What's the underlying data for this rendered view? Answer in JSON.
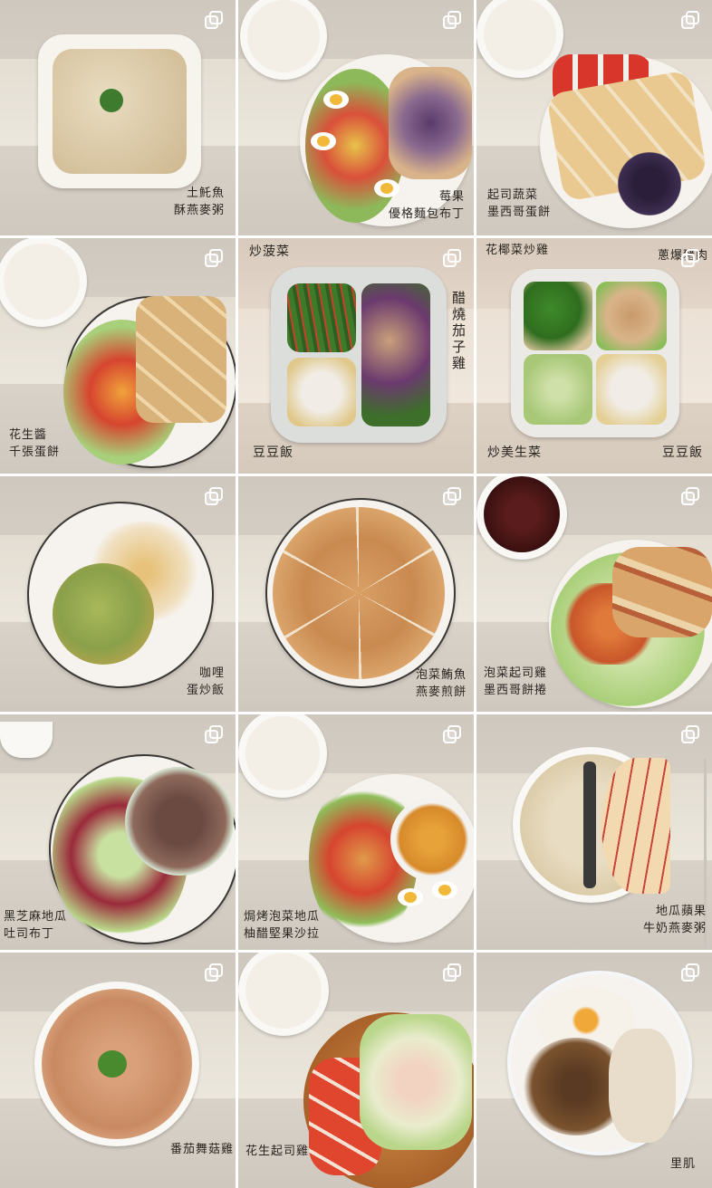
{
  "grid": {
    "tiles": [
      {
        "caption_lines": [
          "土魠魚",
          "酥燕麥粥"
        ]
      },
      {
        "caption_lines": [
          "莓果",
          "優格麵包布丁"
        ]
      },
      {
        "caption_lines": [
          "起司蔬菜",
          "墨西哥蛋餅"
        ]
      },
      {
        "caption_lines": [
          "花生醬",
          "千張蛋餅"
        ]
      },
      {
        "caption_top_left": "炒菠菜",
        "caption_right_vertical": "醋燒茄子雞",
        "caption_bottom": "豆豆飯"
      },
      {
        "caption_top_left": "花椰菜炒雞",
        "caption_top_right": "蔥爆豬肉",
        "caption_bottom_left": "炒美生菜",
        "caption_bottom_right": "豆豆飯"
      },
      {
        "caption_lines": [
          "咖哩",
          "蛋炒飯"
        ]
      },
      {
        "caption_lines": [
          "泡菜鮪魚",
          "燕麥煎餅"
        ]
      },
      {
        "caption_lines": [
          "泡菜起司雞",
          "墨西哥餅捲"
        ]
      },
      {
        "caption_lines": [
          "黑芝麻地瓜",
          "吐司布丁"
        ]
      },
      {
        "caption_lines": [
          "焗烤泡菜地瓜",
          "柚醋堅果沙拉"
        ]
      },
      {
        "caption_lines": [
          "地瓜蘋果",
          "牛奶燕麥粥"
        ]
      },
      {
        "caption_lines": [
          "番茄舞菇雞"
        ]
      },
      {
        "caption_lines": [
          "花生起司雞"
        ]
      },
      {
        "caption_lines": [
          "里肌"
        ]
      }
    ]
  },
  "icons": {
    "multi": "multiple-photos-icon"
  },
  "colors": {
    "background": "#ffffff",
    "caption": "#2a2520"
  }
}
